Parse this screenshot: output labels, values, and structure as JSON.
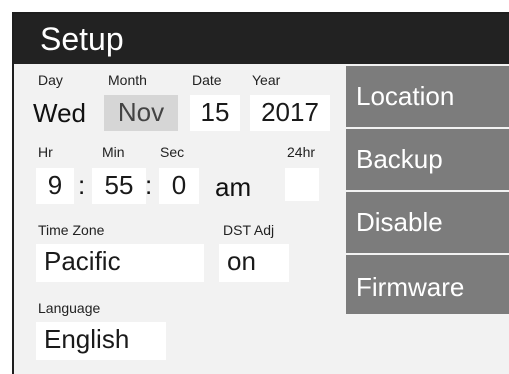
{
  "header": {
    "title": "Setup"
  },
  "datetime": {
    "day": {
      "label": "Day",
      "value": "Wed"
    },
    "month": {
      "label": "Month",
      "value": "Nov"
    },
    "date": {
      "label": "Date",
      "value": "15"
    },
    "year": {
      "label": "Year",
      "value": "2017"
    },
    "hour": {
      "label": "Hr",
      "value": "9"
    },
    "minute": {
      "label": "Min",
      "value": "55"
    },
    "second": {
      "label": "Sec",
      "value": "0"
    },
    "ampm": "am",
    "separator": ":",
    "h24": {
      "label": "24hr",
      "value": ""
    }
  },
  "timezone": {
    "label": "Time Zone",
    "value": "Pacific"
  },
  "dst": {
    "label": "DST Adj",
    "value": "on"
  },
  "language": {
    "label": "Language",
    "value": "English"
  },
  "menu": {
    "items": [
      {
        "label": "Location"
      },
      {
        "label": "Backup"
      },
      {
        "label": "Disable"
      },
      {
        "label": "Firmware"
      }
    ]
  },
  "colors": {
    "titlebar": "#222222",
    "panel": "#f2f2f2",
    "field": "#ffffff",
    "field_selected": "#d6d6d6",
    "menu_button": "#7c7c7c"
  }
}
